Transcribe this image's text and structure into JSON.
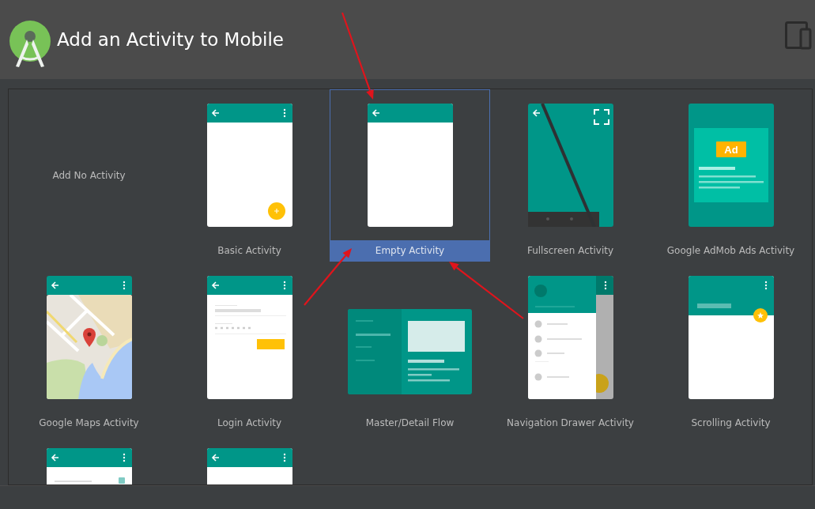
{
  "window": {
    "title": "Add an Activity to Mobile"
  },
  "templates": [
    {
      "label": "Add No Activity",
      "kind": "none",
      "selected": false
    },
    {
      "label": "Basic Activity",
      "kind": "basic",
      "selected": false
    },
    {
      "label": "Empty Activity",
      "kind": "empty",
      "selected": true
    },
    {
      "label": "Fullscreen Activity",
      "kind": "fullscreen",
      "selected": false
    },
    {
      "label": "Google AdMob Ads Activity",
      "kind": "admob",
      "badge": "Ad",
      "selected": false
    },
    {
      "label": "Google Maps Activity",
      "kind": "maps",
      "selected": false
    },
    {
      "label": "Login Activity",
      "kind": "login",
      "selected": false
    },
    {
      "label": "Master/Detail Flow",
      "kind": "masterdetail",
      "selected": false
    },
    {
      "label": "Navigation Drawer Activity",
      "kind": "navdrawer",
      "selected": false
    },
    {
      "label": "Scrolling Activity",
      "kind": "scrolling",
      "selected": false
    },
    {
      "kind": "settings",
      "selected": false
    },
    {
      "kind": "tabbed",
      "selected": false
    }
  ],
  "annotation_arrows": [
    {
      "kind": "down"
    },
    {
      "kind": "upright"
    },
    {
      "kind": "upleft"
    }
  ]
}
